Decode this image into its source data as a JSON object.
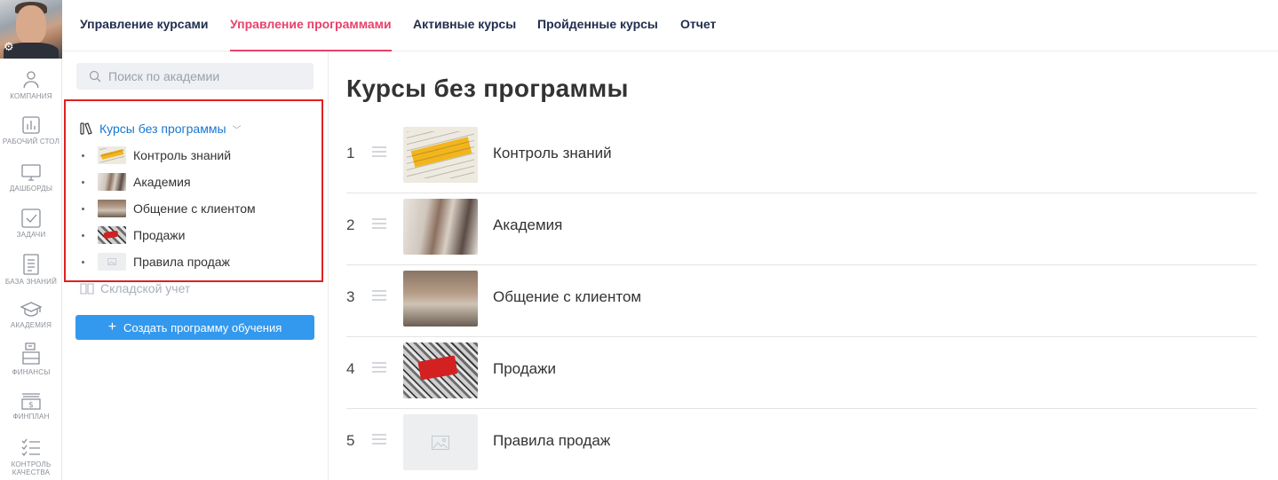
{
  "nav": {
    "tabs": [
      {
        "label": "Управление курсами",
        "active": false
      },
      {
        "label": "Управление программами",
        "active": true
      },
      {
        "label": "Активные курсы",
        "active": false
      },
      {
        "label": "Пройденные курсы",
        "active": false
      },
      {
        "label": "Отчет",
        "active": false
      }
    ]
  },
  "rail": {
    "items": [
      {
        "label": "КОМПАНИЯ",
        "icon": "company-icon"
      },
      {
        "label": "РАБОЧИЙ СТОЛ",
        "icon": "desktop-chart-icon"
      },
      {
        "label": "ДАШБОРДЫ",
        "icon": "monitor-icon"
      },
      {
        "label": "ЗАДАЧИ",
        "icon": "checkbox-icon"
      },
      {
        "label": "БАЗА ЗНАНИЙ",
        "icon": "document-icon"
      },
      {
        "label": "АКАДЕМИЯ",
        "icon": "graduation-cap-icon"
      },
      {
        "label": "ФИНАНСЫ",
        "icon": "cash-register-icon"
      },
      {
        "label": "ФИНПЛАН",
        "icon": "money-stack-icon"
      },
      {
        "label": "КОНТРОЛЬ КАЧЕСТВА",
        "icon": "checklist-icon"
      }
    ]
  },
  "search": {
    "placeholder": "Поиск по академии",
    "value": ""
  },
  "tree": {
    "group_title": "Курсы без программы",
    "courses": [
      {
        "label": "Контроль знаний",
        "thumb": "marketing"
      },
      {
        "label": "Академия",
        "thumb": "academy"
      },
      {
        "label": "Общение с клиентом",
        "thumb": "client"
      },
      {
        "label": "Продажи",
        "thumb": "sales"
      },
      {
        "label": "Правила продаж",
        "thumb": "empty"
      }
    ],
    "second_group": "Складской учет",
    "create_button": "Создать программу обучения"
  },
  "main": {
    "title": "Курсы без программы",
    "rows": [
      {
        "num": "1",
        "name": "Контроль знаний",
        "thumb": "marketing"
      },
      {
        "num": "2",
        "name": "Академия",
        "thumb": "academy"
      },
      {
        "num": "3",
        "name": "Общение с клиентом",
        "thumb": "client"
      },
      {
        "num": "4",
        "name": "Продажи",
        "thumb": "sales"
      },
      {
        "num": "5",
        "name": "Правила продаж",
        "thumb": "empty"
      }
    ]
  },
  "colors": {
    "accent": "#e8416b",
    "link": "#1976d2",
    "button": "#3399ee",
    "highlight_border": "#e02020"
  }
}
